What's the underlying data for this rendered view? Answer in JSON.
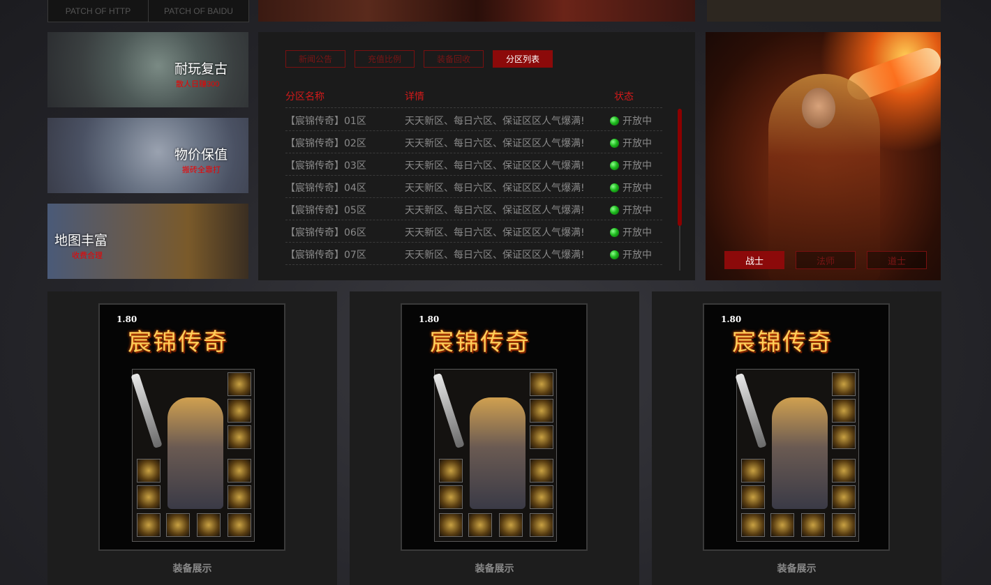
{
  "patch": {
    "buttons": [
      "PATCH OF HTTP",
      "PATCH OF BAIDU"
    ]
  },
  "features": [
    {
      "title": "耐玩复古",
      "subtitle": "散人日赚300"
    },
    {
      "title": "物价保值",
      "subtitle": "搬砖全靠打"
    },
    {
      "title": "地图丰富",
      "subtitle": "收费合理"
    }
  ],
  "server_panel": {
    "tabs": [
      {
        "label": "新闻公告",
        "active": false
      },
      {
        "label": "充值比例",
        "active": false
      },
      {
        "label": "装备回收",
        "active": false
      },
      {
        "label": "分区列表",
        "active": true
      }
    ],
    "headers": {
      "name": "分区名称",
      "detail": "详情",
      "status": "状态"
    },
    "rows": [
      {
        "name": "【宸锦传奇】01区",
        "detail": "天天新区、每日六区、保证区区人气爆满!",
        "status": "开放中"
      },
      {
        "name": "【宸锦传奇】02区",
        "detail": "天天新区、每日六区、保证区区人气爆满!",
        "status": "开放中"
      },
      {
        "name": "【宸锦传奇】03区",
        "detail": "天天新区、每日六区、保证区区人气爆满!",
        "status": "开放中"
      },
      {
        "name": "【宸锦传奇】04区",
        "detail": "天天新区、每日六区、保证区区人气爆满!",
        "status": "开放中"
      },
      {
        "name": "【宸锦传奇】05区",
        "detail": "天天新区、每日六区、保证区区人气爆满!",
        "status": "开放中"
      },
      {
        "name": "【宸锦传奇】06区",
        "detail": "天天新区、每日六区、保证区区人气爆满!",
        "status": "开放中"
      },
      {
        "name": "【宸锦传奇】07区",
        "detail": "天天新区、每日六区、保证区区人气爆满!",
        "status": "开放中"
      }
    ]
  },
  "character": {
    "classes": [
      {
        "label": "战士",
        "active": true
      },
      {
        "label": "法师",
        "active": false
      },
      {
        "label": "道士",
        "active": false
      }
    ]
  },
  "equipment_cards": [
    {
      "level": "1.80",
      "logo": "宸锦传奇",
      "caption": "装备展示"
    },
    {
      "level": "1.80",
      "logo": "宸锦传奇",
      "caption": "装备展示"
    },
    {
      "level": "1.80",
      "logo": "宸锦传奇",
      "caption": "装备展示"
    }
  ],
  "colors": {
    "accent_red": "#8c0a0a",
    "header_red": "#d21a1a",
    "status_green": "#1ebb1e",
    "panel_bg": "#1b1b1b"
  }
}
